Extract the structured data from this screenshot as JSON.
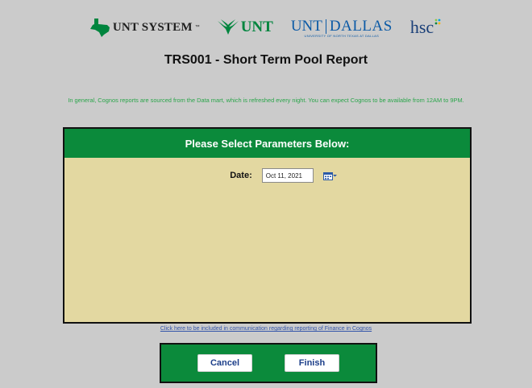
{
  "logos": {
    "unt_system": "UNT SYSTEM",
    "unt_system_tm": "™",
    "unt": "UNT",
    "unt_dallas_a": "UNT",
    "unt_dallas_b": "DALLAS",
    "unt_dallas_sub": "UNIVERSITY OF NORTH TEXAS AT DALLAS",
    "hsc": "hsc"
  },
  "report": {
    "title": "TRS001 - Short Term Pool Report",
    "notice": "In general, Cognos reports are sourced from the Data mart, which is refreshed every night. You can expect Cognos to be available from 12AM to 9PM."
  },
  "panel": {
    "heading": "Please Select Parameters Below:",
    "date_label": "Date:",
    "date_value": "Oct 11, 2021"
  },
  "footer": {
    "link": "Click here to be included in communication regarding reporting of Finance in Cognos",
    "cancel_label": "Cancel",
    "finish_label": "Finish"
  },
  "colors": {
    "brand_green": "#0b8a3b",
    "panel_bg": "#e3d8a1",
    "page_bg": "#cbcbcb",
    "notice_green": "#2aa54a",
    "dallas_blue": "#0b5aa6"
  },
  "icons": [
    "texas-shape-icon",
    "eagle-icon",
    "hsc-dots-icon",
    "calendar-icon",
    "dropdown-arrow-icon"
  ]
}
